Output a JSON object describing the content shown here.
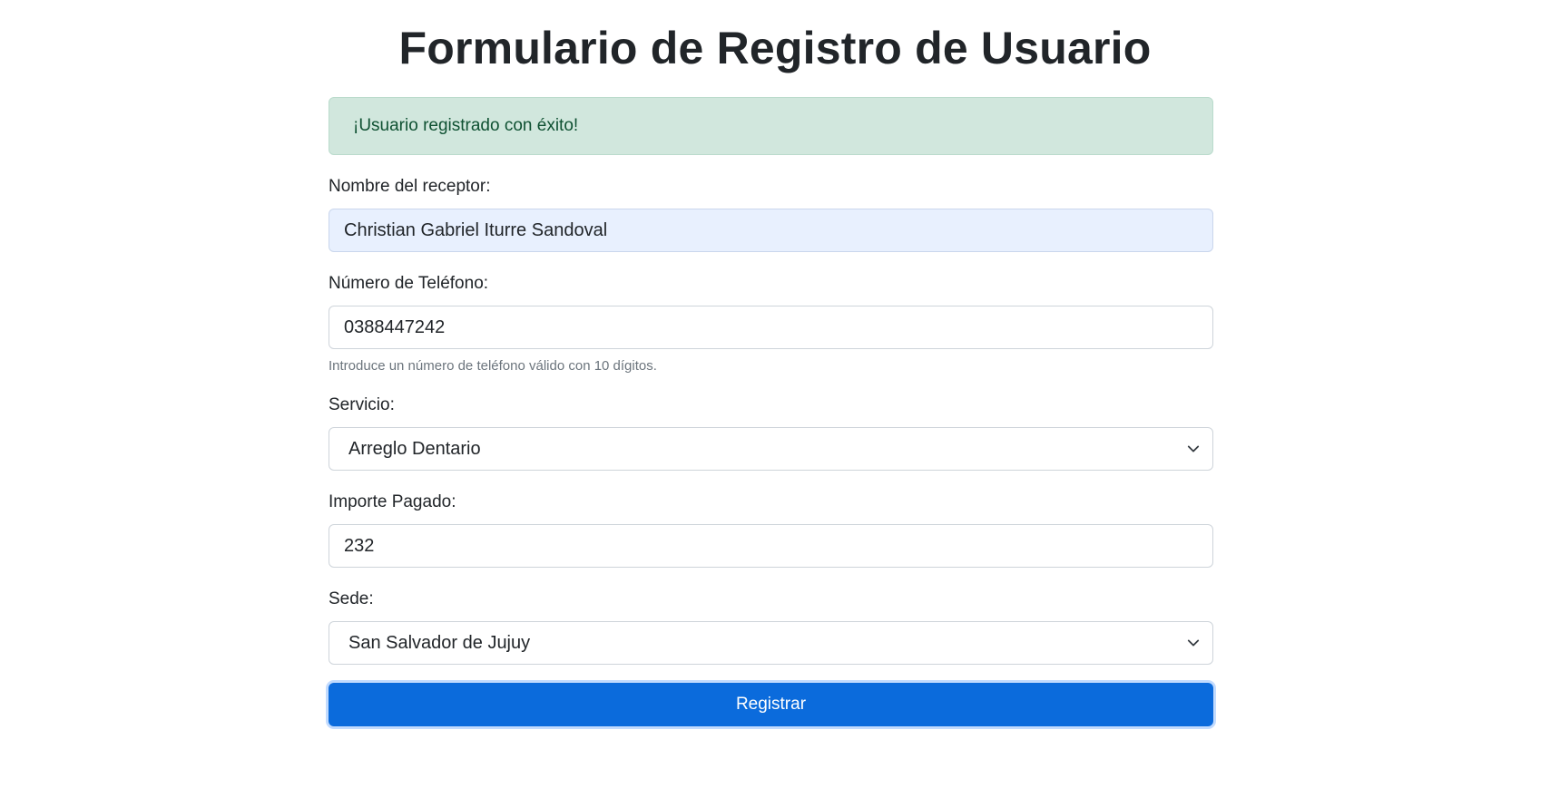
{
  "page": {
    "title": "Formulario de Registro de Usuario"
  },
  "alert": {
    "message": "¡Usuario registrado con éxito!",
    "color": "#d1e7dd"
  },
  "form": {
    "receiver": {
      "label": "Nombre del receptor:",
      "value": "Christian Gabriel Iturre Sandoval"
    },
    "phone": {
      "label": "Número de Teléfono:",
      "value": "0388447242",
      "help": "Introduce un número de teléfono válido con 10 dígitos."
    },
    "service": {
      "label": "Servicio:",
      "selected": "Arreglo Dentario",
      "icon": "chevron-down-icon"
    },
    "amount": {
      "label": "Importe Pagado:",
      "value": "232"
    },
    "site": {
      "label": "Sede:",
      "selected": "San Salvador de Jujuy",
      "icon": "chevron-down-icon"
    },
    "submit": {
      "label": "Registrar",
      "color": "#0b6bdc"
    }
  }
}
